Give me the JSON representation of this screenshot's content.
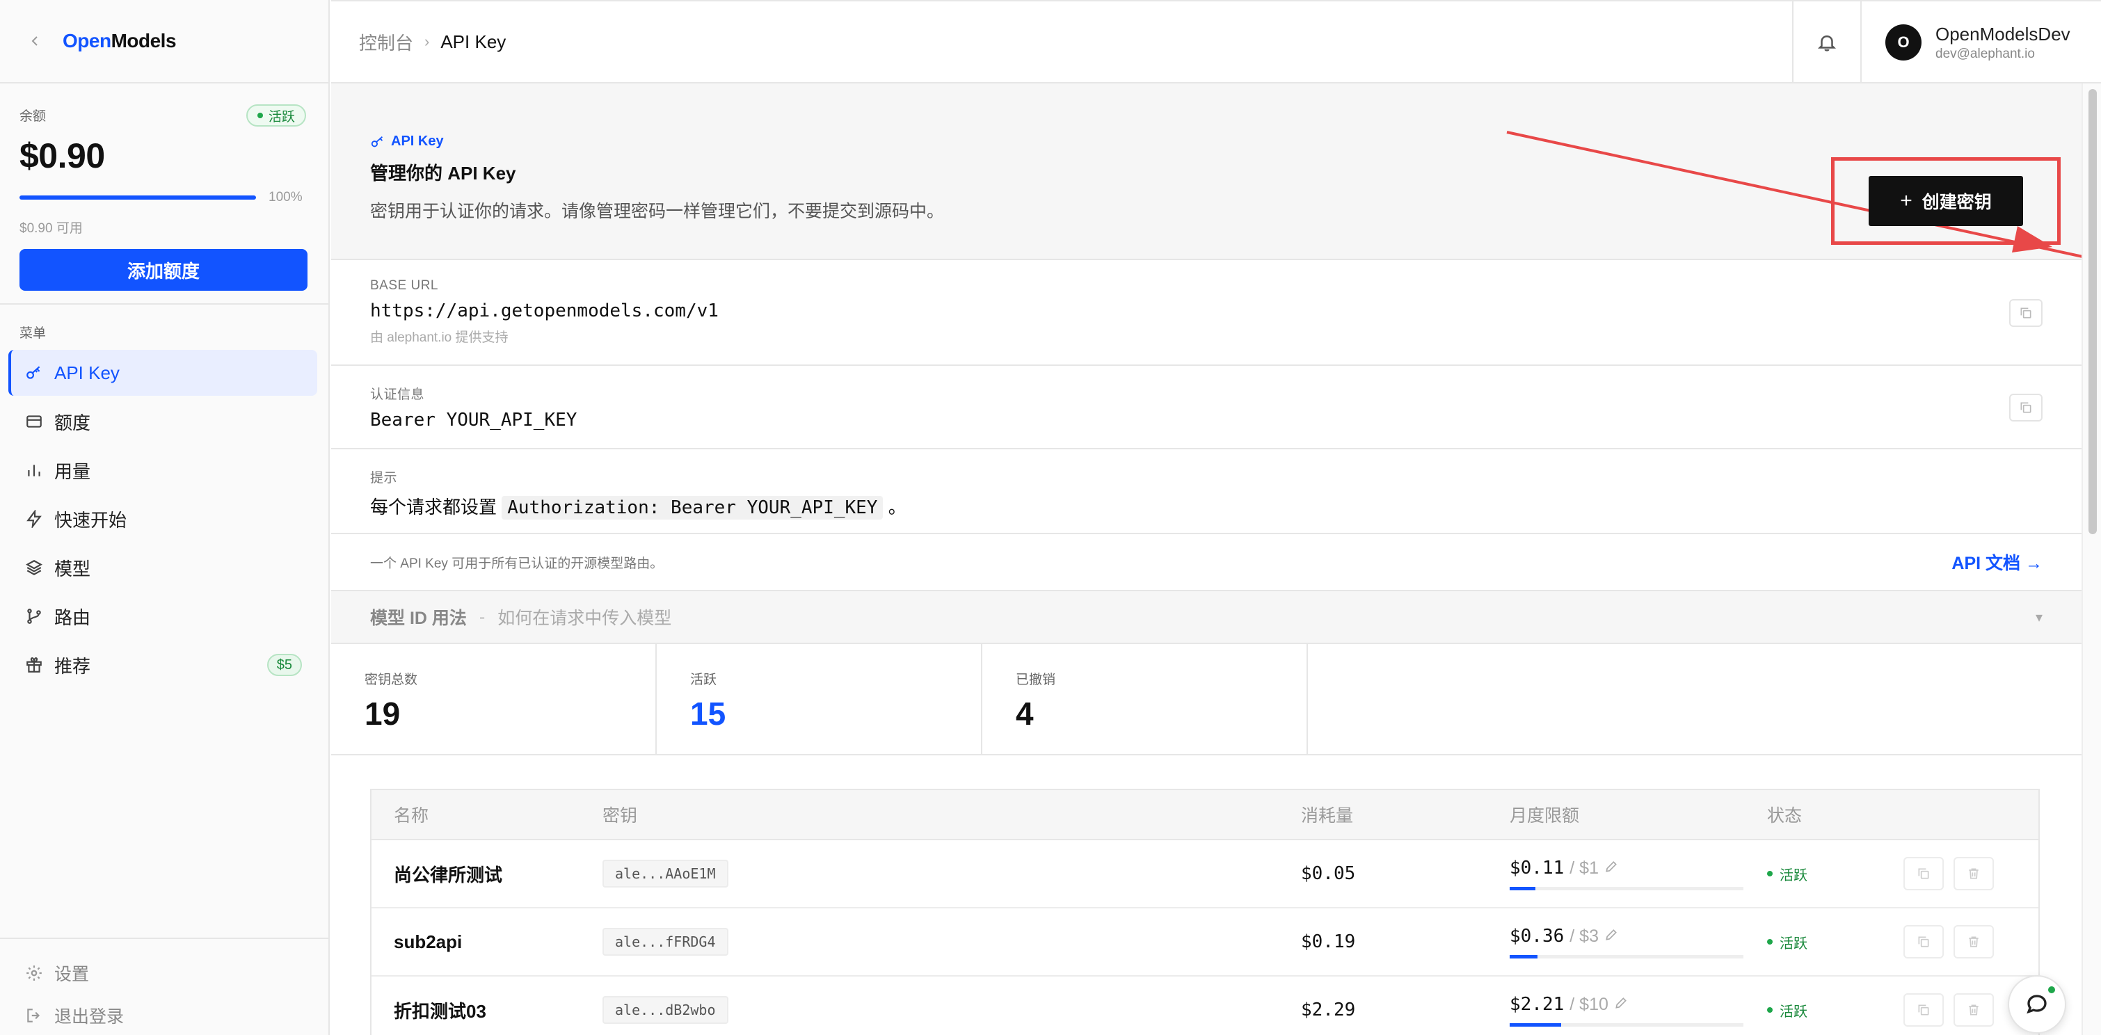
{
  "sidebar": {
    "logo_open": "Open",
    "logo_models": "Models",
    "balance_label": "余额",
    "status_badge": "活跃",
    "balance_amount": "$0.90",
    "balance_percent_label": "100%",
    "balance_fill_fraction": 1.0,
    "balance_available": "$0.90 可用",
    "add_credit_label": "添加额度",
    "menu_title": "菜单",
    "menu_items": [
      {
        "label": "API Key",
        "icon": "key-icon",
        "active": true
      },
      {
        "label": "额度",
        "icon": "card-icon",
        "active": false
      },
      {
        "label": "用量",
        "icon": "bar-chart-icon",
        "active": false
      },
      {
        "label": "快速开始",
        "icon": "lightning-icon",
        "active": false
      },
      {
        "label": "模型",
        "icon": "layers-icon",
        "active": false
      },
      {
        "label": "路由",
        "icon": "git-branch-icon",
        "active": false
      },
      {
        "label": "推荐",
        "icon": "gift-icon",
        "active": false,
        "badge": "$5"
      }
    ],
    "settings_label": "设置",
    "logout_label": "退出登录"
  },
  "topbar": {
    "breadcrumb_home": "控制台",
    "breadcrumb_current": "API Key",
    "user_initial": "O",
    "user_name": "OpenModelsDev",
    "user_email": "dev@alephant.io"
  },
  "hero": {
    "tag": "API Key",
    "title": "管理你的 API Key",
    "description": "密钥用于认证你的请求。请像管理密码一样管理它们，不要提交到源码中。",
    "create_label": "创建密钥",
    "highlight_color": "#e84848"
  },
  "base_url": {
    "label": "BASE URL",
    "value": "https://api.getopenmodels.com/v1",
    "sub": "由 alephant.io 提供支持"
  },
  "auth": {
    "label": "认证信息",
    "value": "Bearer YOUR_API_KEY"
  },
  "tip": {
    "label": "提示",
    "prefix": "每个请求都设置",
    "code": "Authorization: Bearer YOUR_API_KEY",
    "suffix": "。"
  },
  "footer_note": {
    "text": "一个 API Key 可用于所有已认证的开源模型路由。",
    "doc_link": "API 文档 →"
  },
  "model_usage": {
    "title": "模型 ID 用法",
    "separator": "-",
    "description": "如何在请求中传入模型"
  },
  "stats": [
    {
      "label": "密钥总数",
      "value": "19"
    },
    {
      "label": "活跃",
      "value": "15"
    },
    {
      "label": "已撤销",
      "value": "4"
    }
  ],
  "table": {
    "headers": [
      "名称",
      "密钥",
      "消耗量",
      "月度限额",
      "状态"
    ],
    "rows": [
      {
        "name": "尚公律所测试",
        "key": "ale...AAoE1M",
        "used": "$0.05",
        "limit_used": "$0.11",
        "limit_cap": "/ $1",
        "fill": 0.11,
        "status": "活跃"
      },
      {
        "name": "sub2api",
        "key": "ale...fFRDG4",
        "used": "$0.19",
        "limit_used": "$0.36",
        "limit_cap": "/ $3",
        "fill": 0.12,
        "status": "活跃"
      },
      {
        "name": "折扣测试03",
        "key": "ale...dB2wbo",
        "used": "$2.29",
        "limit_used": "$2.21",
        "limit_cap": "/ $10",
        "fill": 0.22,
        "status": "活跃"
      }
    ]
  },
  "colors": {
    "accent": "#1254ff",
    "success": "#18883a"
  }
}
